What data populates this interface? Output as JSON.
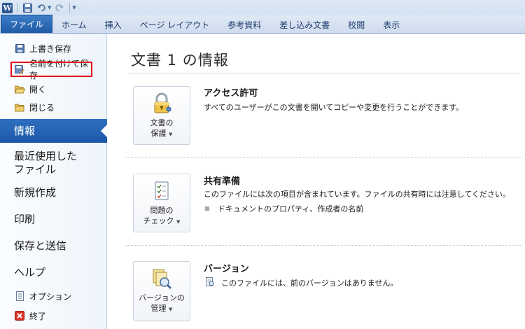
{
  "app": {
    "logo_letter": "W"
  },
  "ribbon": {
    "tabs": [
      {
        "label": "ファイル",
        "active": true
      },
      {
        "label": "ホーム"
      },
      {
        "label": "挿入"
      },
      {
        "label": "ページ レイアウト"
      },
      {
        "label": "参考資料"
      },
      {
        "label": "差し込み文書"
      },
      {
        "label": "校閲"
      },
      {
        "label": "表示"
      }
    ]
  },
  "sidebar": {
    "overwrite_save": "上書き保存",
    "save_as": "名前を付けて保存",
    "open": "開く",
    "close": "閉じる",
    "info": "情報",
    "recent_line1": "最近使用した",
    "recent_line2": "ファイル",
    "new": "新規作成",
    "print": "印刷",
    "save_send": "保存と送信",
    "help": "ヘルプ",
    "options": "オプション",
    "exit": "終了"
  },
  "main": {
    "title": "文書 1 の情報",
    "sections": [
      {
        "button_line1": "文書の",
        "button_line2": "保護",
        "heading": "アクセス許可",
        "description": "すべてのユーザーがこの文書を開いてコピーや変更を行うことができます。",
        "icon": "lock-key-icon"
      },
      {
        "button_line1": "問題の",
        "button_line2": "チェック",
        "heading": "共有準備",
        "description": "このファイルには次の項目が含まれています。ファイルの共有時には注意してください。",
        "bullet": "ドキュメントのプロパティ、作成者の名前",
        "icon": "checklist-icon"
      },
      {
        "button_line1": "バージョンの",
        "button_line2": "管理",
        "heading": "バージョン",
        "description": "このファイルには、前のバージョンはありません。",
        "icon": "versions-icon"
      }
    ]
  },
  "colors": {
    "file_tab": "#2a67b4",
    "highlight_border": "#e0101a",
    "active_item": "#2563b4"
  }
}
